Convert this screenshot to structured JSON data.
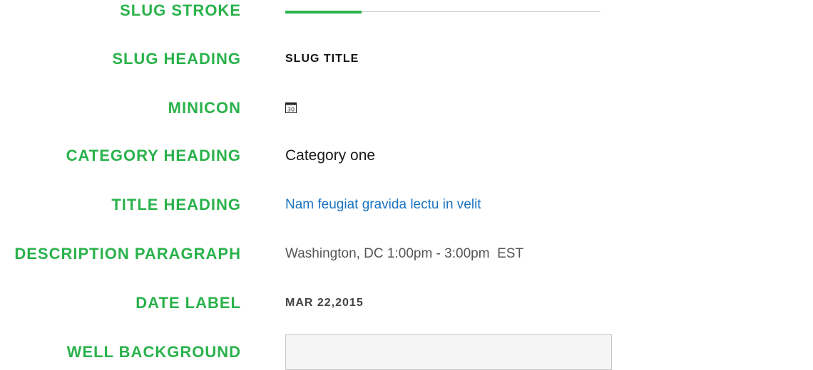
{
  "rows": {
    "slug_stroke": {
      "label": "SLUG STROKE"
    },
    "slug_heading": {
      "label": "SLUG HEADING",
      "value": "SLUG TITLE"
    },
    "minicon": {
      "label": "MINICON",
      "icon": "calendar-icon",
      "icon_text": "30"
    },
    "category_heading": {
      "label": "CATEGORY HEADING",
      "value": "Category one"
    },
    "title_heading": {
      "label": "TITLE HEADING",
      "value": "Nam feugiat gravida lectu in velit"
    },
    "description_paragraph": {
      "label": "DESCRIPTION PARAGRAPH",
      "value": "Washington, DC 1:00pm - 3:00pm  EST"
    },
    "date_label": {
      "label": "DATE LABEL",
      "value": "MAR 22,2015"
    },
    "well_background": {
      "label": "WELL BACKGROUND"
    }
  },
  "colors": {
    "label_green": "#2ab24b",
    "stroke_green": "#2ab24b",
    "stroke_gray": "#c8c8c8",
    "link_blue": "#1a73c0",
    "well_bg": "#f5f5f5"
  }
}
